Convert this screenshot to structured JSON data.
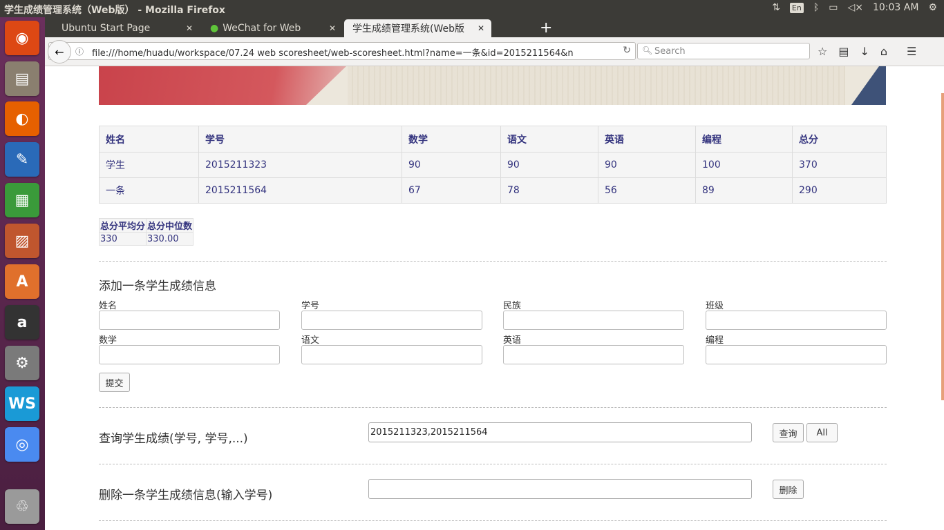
{
  "window": {
    "title": "学生成绩管理系统（Web版） - Mozilla Firefox"
  },
  "tray": {
    "lang": "En",
    "time": "10:03 AM"
  },
  "tabs": [
    {
      "label": "Ubuntu Start Page"
    },
    {
      "label": "WeChat for Web"
    },
    {
      "label": "学生成绩管理系统(Web版"
    }
  ],
  "nav": {
    "url": "file:///home/huadu/workspace/07.24 web scoresheet/web-scoresheet.html?name=一条&id=2015211564&n",
    "search_placeholder": "Search"
  },
  "launcher": [
    {
      "name": "ubuntu-dash-icon",
      "glyph": "◉",
      "color": "#dd4814"
    },
    {
      "name": "files-icon",
      "glyph": "▤",
      "color": "#8a7f6f"
    },
    {
      "name": "firefox-icon",
      "glyph": "◐",
      "color": "#e66000"
    },
    {
      "name": "writer-icon",
      "glyph": "✎",
      "color": "#2a6ab8"
    },
    {
      "name": "calc-icon",
      "glyph": "▦",
      "color": "#3a9a3a"
    },
    {
      "name": "impress-icon",
      "glyph": "▨",
      "color": "#c0562e"
    },
    {
      "name": "software-center-icon",
      "glyph": "A",
      "color": "#e0702c"
    },
    {
      "name": "amazon-icon",
      "glyph": "a",
      "color": "#333333"
    },
    {
      "name": "system-settings-icon",
      "glyph": "⚙",
      "color": "#7a7a7a"
    },
    {
      "name": "webstorm-icon",
      "glyph": "WS",
      "color": "#1a9ad6"
    },
    {
      "name": "chrome-icon",
      "glyph": "◎",
      "color": "#4a8af0"
    },
    {
      "name": "trash-icon",
      "glyph": "♲",
      "color": "#9a9a9a"
    }
  ],
  "scores": {
    "headers": [
      "姓名",
      "学号",
      "数学",
      "语文",
      "英语",
      "编程",
      "总分"
    ],
    "rows": [
      [
        "学生",
        "2015211323",
        "90",
        "90",
        "90",
        "100",
        "370"
      ],
      [
        "一条",
        "2015211564",
        "67",
        "78",
        "56",
        "89",
        "290"
      ]
    ]
  },
  "stats": {
    "headers": [
      "总分平均分",
      "总分中位数"
    ],
    "values": [
      "330",
      "330.00"
    ]
  },
  "add_form": {
    "title": "添加一条学生成绩信息",
    "labels": [
      "姓名",
      "学号",
      "民族",
      "班级",
      "数学",
      "语文",
      "英语",
      "编程"
    ],
    "submit": "提交"
  },
  "query": {
    "label": "查询学生成绩(学号, 学号,...)",
    "value": "2015211323,2015211564",
    "query_button": "查询",
    "all_button": "All"
  },
  "delete": {
    "label": "删除一条学生成绩信息(输入学号)",
    "value": "",
    "button": "删除"
  }
}
